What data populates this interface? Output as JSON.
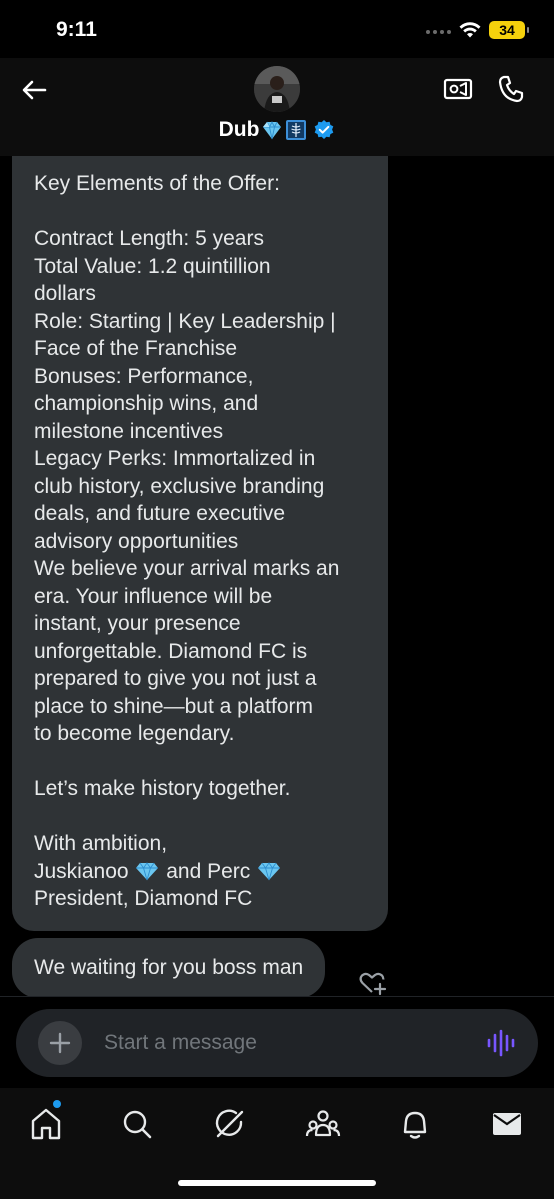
{
  "status_bar": {
    "time": "9:11",
    "battery": "34",
    "battery_color": "#f5d10c"
  },
  "header": {
    "contact_name": "Dub",
    "name_emojis": [
      "gem-icon",
      "x-ray-icon"
    ],
    "verified": true,
    "verified_color": "#1d9bf0",
    "back_icon": "arrow-left-icon",
    "video_icon": "video-call-icon",
    "call_icon": "phone-icon"
  },
  "messages": [
    {
      "sender": "contact",
      "lines": [
        "Key Elements of the Offer:",
        "",
        "Contract Length: 5 years",
        "Total Value: 1.2 quintillion",
        "dollars",
        "Role: Starting | Key Leadership |",
        "Face of the Franchise",
        "Bonuses: Performance,",
        "championship wins, and",
        "milestone incentives",
        "Legacy Perks: Immortalized in",
        "club history, exclusive branding",
        "deals, and future executive",
        "advisory opportunities",
        "We believe your arrival marks an",
        "era. Your influence will be",
        "instant, your presence",
        "unforgettable. Diamond FC is",
        "prepared to give you not just a",
        "place to shine—but a platform",
        "to become legendary.",
        "",
        "Let’s make history together.",
        "",
        "With ambition,"
      ],
      "signature_a": "Juskianoo",
      "signature_and": "and Perc",
      "signature_title": "President, Diamond FC"
    },
    {
      "sender": "contact",
      "text": "We waiting for you boss man"
    }
  ],
  "composer": {
    "placeholder": "Start a message",
    "accent": "#7856ff"
  },
  "tabs": [
    "home-icon",
    "search-icon",
    "grok-icon",
    "communities-icon",
    "notifications-icon",
    "messages-icon"
  ],
  "colors": {
    "bubble": "#2f3336",
    "background": "#000000",
    "accent_blue": "#1d9bf0"
  }
}
